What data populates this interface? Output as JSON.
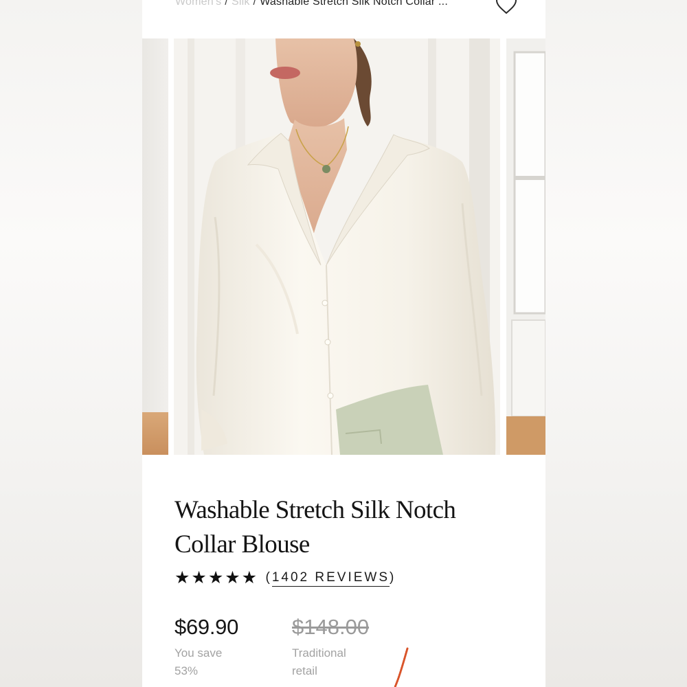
{
  "breadcrumb": {
    "level1": "Women's",
    "separator": "/",
    "level2": "Silk",
    "current": "Washable Stretch Silk Notch Collar ..."
  },
  "product": {
    "title_line1": "Washable Stretch Silk Notch",
    "title_line2": "Collar Blouse",
    "stars": "★★★★★",
    "rating": 5,
    "reviews_open": "(",
    "reviews_text": "1402 REVIEWS",
    "reviews_close": ")",
    "price": "$69.90",
    "original_price": "$148.00",
    "save_line1": "You save",
    "save_line2": "53%",
    "retail_line1": "Traditional",
    "retail_line2": "retail"
  },
  "icons": {
    "wishlist": "heart-outline-icon",
    "rating_star": "star-icon"
  },
  "colors": {
    "text": "#141414",
    "muted": "#a2a2a2",
    "strike": "#9a9a9a",
    "blouse": "#f7f3ea",
    "skirt": "#c9d1b8"
  }
}
